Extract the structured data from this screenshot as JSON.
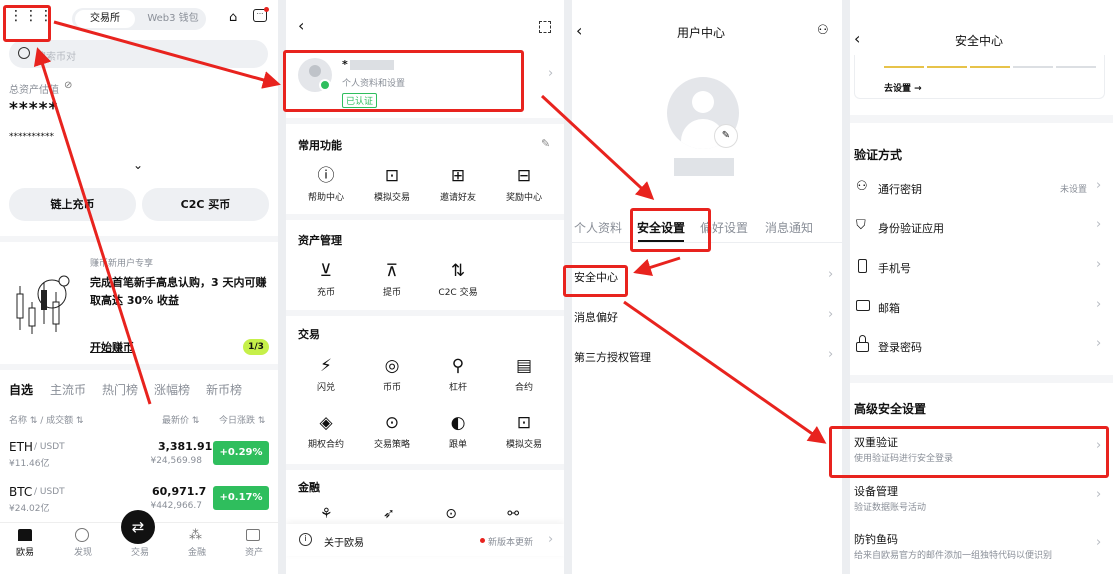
{
  "p1": {
    "tabs": [
      "交易所",
      "Web3 钱包"
    ],
    "search_placeholder": "搜索币对",
    "asset_label": "总资产估值",
    "asset_value": "*****",
    "asset_sub": "**********",
    "btn_deposit": "链上充币",
    "btn_c2c": "C2C 买币",
    "promo_tag": "赚币新用户专享",
    "promo_text": "完成首笔新手高息认购，3 天内可赚取高达 30% 收益",
    "promo_link": "开始赚币",
    "promo_page": "1/3",
    "market_tabs": [
      "自选",
      "主流币",
      "热门榜",
      "涨幅榜",
      "新币榜"
    ],
    "col_name": "名称 ⇅ / 成交额 ⇅",
    "col_price": "最新价 ⇅",
    "col_change": "今日涨跌 ⇅",
    "rows": [
      {
        "sym": "ETH",
        "quote": "/ USDT",
        "vol": "¥11.46亿",
        "price": "3,381.91",
        "cny": "¥24,569.98",
        "chg": "+0.29%"
      },
      {
        "sym": "BTC",
        "quote": "/ USDT",
        "vol": "¥24.02亿",
        "price": "60,971.7",
        "cny": "¥442,966.7",
        "chg": "+0.17%"
      }
    ],
    "nav": [
      "欧易",
      "发现",
      "交易",
      "金融",
      "资产"
    ]
  },
  "p2": {
    "profile_name": "*",
    "profile_sub": "个人资料和设置",
    "profile_badge": "已认证",
    "sec_common": "常用功能",
    "common": [
      "帮助中心",
      "模拟交易",
      "邀请好友",
      "奖励中心"
    ],
    "sec_asset": "资产管理",
    "asset": [
      "充币",
      "提币",
      "C2C 交易"
    ],
    "sec_trade": "交易",
    "trade": [
      "闪兑",
      "币币",
      "杠杆",
      "合约",
      "期权合约",
      "交易策略",
      "跟单",
      "模拟交易"
    ],
    "sec_fin": "金融",
    "about": "关于欧易",
    "update": "新版本更新"
  },
  "p3": {
    "title": "用户中心",
    "tabs": [
      "个人资料",
      "安全设置",
      "偏好设置",
      "消息通知"
    ],
    "items": [
      "安全中心",
      "消息偏好",
      "第三方授权管理"
    ]
  },
  "p4": {
    "title": "安全中心",
    "go_set": "去设置 →",
    "sec_verify": "验证方式",
    "verify": [
      {
        "label": "通行密钥",
        "value": "未设置"
      },
      {
        "label": "身份验证应用",
        "value": ""
      },
      {
        "label": "手机号",
        "value": ""
      },
      {
        "label": "邮箱",
        "value": ""
      },
      {
        "label": "登录密码",
        "value": ""
      }
    ],
    "sec_adv": "高级安全设置",
    "adv": [
      {
        "label": "双重验证",
        "sub": "使用验证码进行安全登录"
      },
      {
        "label": "设备管理",
        "sub": "验证数据账号活动"
      },
      {
        "label": "防钓鱼码",
        "sub": "给来自欧易官方的邮件添加一组独特代码以便识别"
      }
    ]
  },
  "colors": {
    "accent": "#e8231e",
    "green": "#2fbe5d",
    "badge_bg": "#c6f04a"
  }
}
